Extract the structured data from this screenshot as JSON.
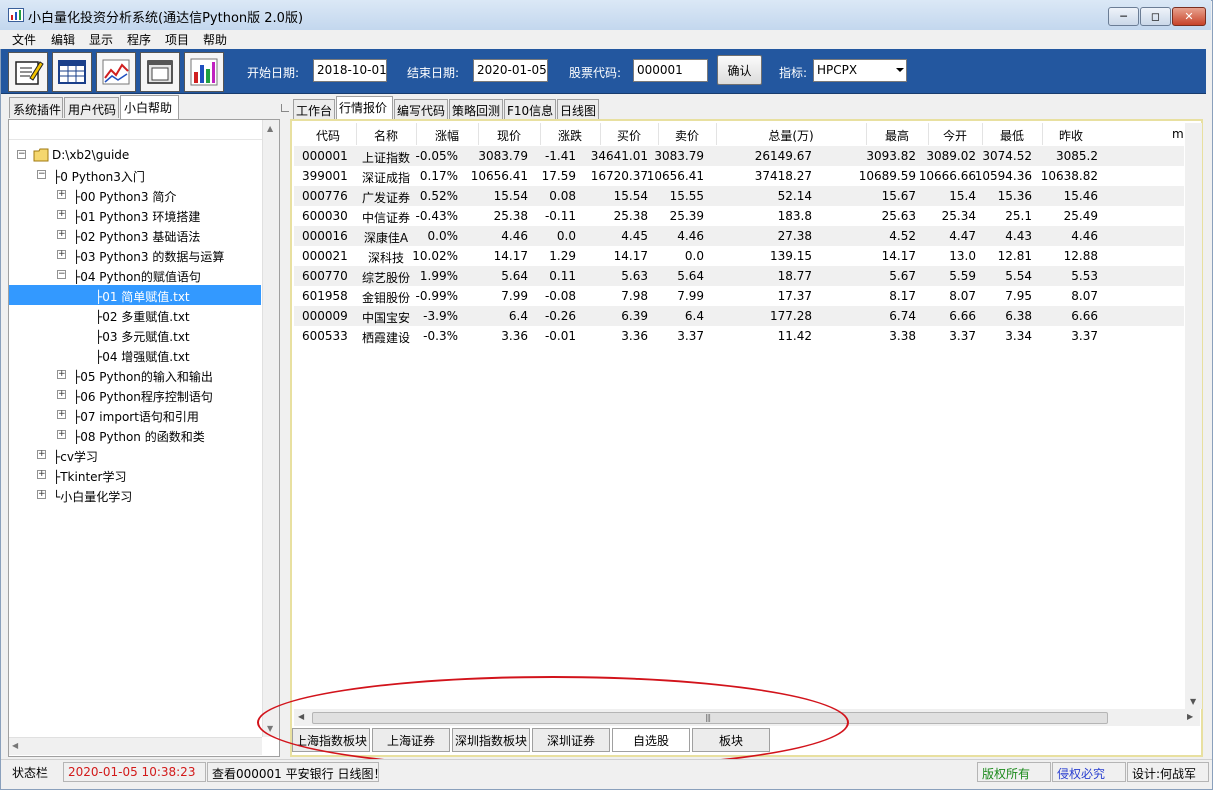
{
  "window": {
    "title": "小白量化投资分析系统(通达信Python版 2.0版)"
  },
  "menu": [
    "文件",
    "编辑",
    "显示",
    "程序",
    "项目",
    "帮助"
  ],
  "toolbar": {
    "start_label": "开始日期:",
    "start_value": "2018-10-01",
    "end_label": "结束日期:",
    "end_value": "2020-01-05",
    "code_label": "股票代码:",
    "code_value": "000001",
    "confirm": "确认",
    "indicator_label": "指标:",
    "indicator_value": "HPCPX",
    "icons": [
      "edit-icon",
      "table-icon",
      "line-chart-icon",
      "window-icon",
      "bar-chart-icon"
    ]
  },
  "left_tabs": [
    "系统插件",
    "用户代码",
    "小白帮助"
  ],
  "tree": [
    {
      "label": "D:\\xb2\\guide",
      "level": 0,
      "expander": "−",
      "folder": true
    },
    {
      "label": "├0 Python3入门",
      "level": 1,
      "expander": "−"
    },
    {
      "label": "├00 Python3 简介",
      "level": 2,
      "expander": "+"
    },
    {
      "label": "├01 Python3 环境搭建",
      "level": 2,
      "expander": "+"
    },
    {
      "label": "├02 Python3 基础语法",
      "level": 2,
      "expander": "+"
    },
    {
      "label": "├03 Python3 的数据与运算",
      "level": 2,
      "expander": "+"
    },
    {
      "label": "├04 Python的赋值语句",
      "level": 2,
      "expander": "−"
    },
    {
      "label": "├01 简单赋值.txt",
      "level": 3,
      "expander": "",
      "selected": true
    },
    {
      "label": "├02 多重赋值.txt",
      "level": 3,
      "expander": ""
    },
    {
      "label": "├03 多元赋值.txt",
      "level": 3,
      "expander": ""
    },
    {
      "label": "├04 增强赋值.txt",
      "level": 3,
      "expander": ""
    },
    {
      "label": "├05 Python的输入和输出",
      "level": 2,
      "expander": "+"
    },
    {
      "label": "├06 Python程序控制语句",
      "level": 2,
      "expander": "+"
    },
    {
      "label": "├07 import语句和引用",
      "level": 2,
      "expander": "+"
    },
    {
      "label": "├08 Python 的函数和类",
      "level": 2,
      "expander": "+"
    },
    {
      "label": "├cv学习",
      "level": 1,
      "expander": "+"
    },
    {
      "label": "├Tkinter学习",
      "level": 1,
      "expander": "+"
    },
    {
      "label": "└小白量化学习",
      "level": 1,
      "expander": "+"
    }
  ],
  "right_tabs": [
    "工作台",
    "行情报价",
    "编写代码",
    "策略回测",
    "F10信息",
    "日线图"
  ],
  "table": {
    "headers": [
      "代码",
      "名称",
      "涨幅",
      "现价",
      "涨跌",
      "买价",
      "卖价",
      "总量(万)",
      "最高",
      "今开",
      "最低",
      "昨收",
      "m"
    ],
    "rows": [
      [
        "000001",
        "上证指数",
        "-0.05%",
        "3083.79",
        "-1.41",
        "34641.01",
        "3083.79",
        "26149.67",
        "3093.82",
        "3089.02",
        "3074.52",
        "3085.2"
      ],
      [
        "399001",
        "深证成指",
        "0.17%",
        "10656.41",
        "17.59",
        "16720.37",
        "10656.41",
        "37418.27",
        "10689.59",
        "10666.66",
        "10594.36",
        "10638.82"
      ],
      [
        "000776",
        "广发证券",
        "0.52%",
        "15.54",
        "0.08",
        "15.54",
        "15.55",
        "52.14",
        "15.67",
        "15.4",
        "15.36",
        "15.46"
      ],
      [
        "600030",
        "中信证券",
        "-0.43%",
        "25.38",
        "-0.11",
        "25.38",
        "25.39",
        "183.8",
        "25.63",
        "25.34",
        "25.1",
        "25.49"
      ],
      [
        "000016",
        "深康佳A",
        "0.0%",
        "4.46",
        "0.0",
        "4.45",
        "4.46",
        "27.38",
        "4.52",
        "4.47",
        "4.43",
        "4.46"
      ],
      [
        "000021",
        "深科技",
        "10.02%",
        "14.17",
        "1.29",
        "14.17",
        "0.0",
        "139.15",
        "14.17",
        "13.0",
        "12.81",
        "12.88"
      ],
      [
        "600770",
        "综艺股份",
        "1.99%",
        "5.64",
        "0.11",
        "5.63",
        "5.64",
        "18.77",
        "5.67",
        "5.59",
        "5.54",
        "5.53"
      ],
      [
        "601958",
        "金钼股份",
        "-0.99%",
        "7.99",
        "-0.08",
        "7.98",
        "7.99",
        "17.37",
        "8.17",
        "8.07",
        "7.95",
        "8.07"
      ],
      [
        "000009",
        "中国宝安",
        "-3.9%",
        "6.4",
        "-0.26",
        "6.39",
        "6.4",
        "177.28",
        "6.74",
        "6.66",
        "6.38",
        "6.66"
      ],
      [
        "600533",
        "栖霞建设",
        "-0.3%",
        "3.36",
        "-0.01",
        "3.36",
        "3.37",
        "11.42",
        "3.38",
        "3.37",
        "3.34",
        "3.37"
      ]
    ]
  },
  "bottom_tabs": [
    "上海指数板块",
    "上海证券",
    "深圳指数板块",
    "深圳证券",
    "自选股",
    "板块"
  ],
  "status": {
    "label": "状态栏",
    "datetime": "2020-01-05  10:38:23",
    "message": "查看000001 平安银行 日线图！",
    "copyright": "版权所有",
    "infringe": "侵权必究",
    "designer": "设计:何战军"
  },
  "colors": {
    "toolbar_bg": "#23579f",
    "status_red": "#d21a1a",
    "status_green": "#1a8a1a",
    "status_blue": "#2a3fd0",
    "annotation": "#d2131b"
  }
}
